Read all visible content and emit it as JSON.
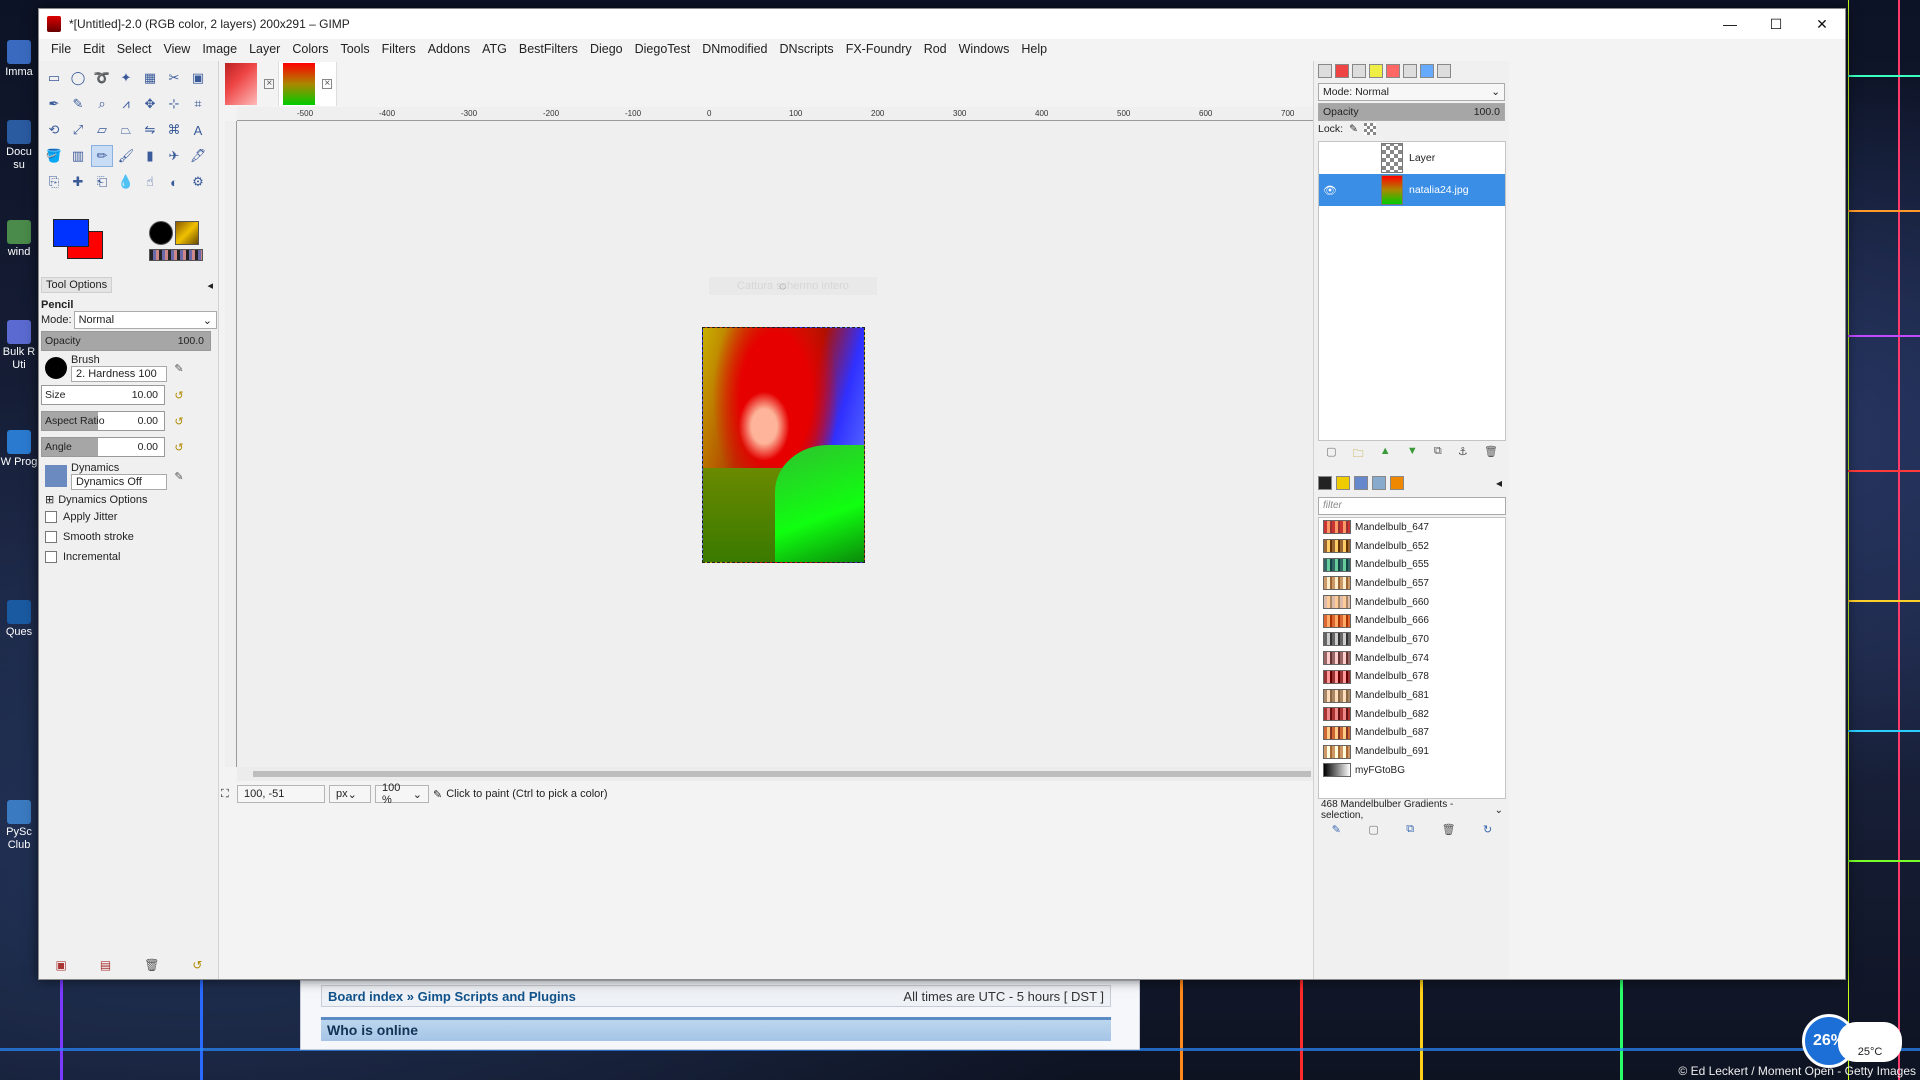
{
  "window": {
    "title": "*[Untitled]-2.0 (RGB color, 2 layers) 200x291 – GIMP",
    "controls": {
      "minimize": "—",
      "maximize": "☐",
      "close": "✕"
    }
  },
  "menu": [
    "File",
    "Edit",
    "Select",
    "View",
    "Image",
    "Layer",
    "Colors",
    "Tools",
    "Filters",
    "Addons",
    "ATG",
    "BestFilters",
    "Diego",
    "DiegoTest",
    "DNmodified",
    "DNscripts",
    "FX-Foundry",
    "Rod",
    "Windows",
    "Help"
  ],
  "desktop_icons": [
    "Imma",
    "Docu su",
    "wind",
    "Bulk R Uti",
    "W Prog",
    "Ques",
    "PySc Club"
  ],
  "tool_options": {
    "tab": "Tool Options",
    "tool_name": "Pencil",
    "mode_label": "Mode:",
    "mode_value": "Normal",
    "opacity_label": "Opacity",
    "opacity_value": "100.0",
    "brush_label": "Brush",
    "brush_value": "2. Hardness 100",
    "size_label": "Size",
    "size_value": "10.00",
    "aspect_label": "Aspect Ratio",
    "aspect_value": "0.00",
    "angle_label": "Angle",
    "angle_value": "0.00",
    "dynamics_label": "Dynamics",
    "dynamics_value": "Dynamics Off",
    "dynamics_options": "Dynamics Options",
    "apply_jitter": "Apply Jitter",
    "smooth_stroke": "Smooth stroke",
    "incremental": "Incremental"
  },
  "colors": {
    "foreground": "#0033ff",
    "background": "#ff0000"
  },
  "ruler_labels": [
    "-500",
    "-400",
    "-300",
    "-200",
    "-100",
    "0",
    "100",
    "200",
    "300",
    "400",
    "500",
    "600",
    "700"
  ],
  "canvas": {
    "ghost_text": "Cattura schermo intero"
  },
  "statusbar": {
    "coords": "100, -51",
    "unit": "px",
    "zoom": "100 %",
    "message": "Click to paint (Ctrl to pick a color)"
  },
  "layers": {
    "mode_label": "Mode: Normal",
    "opacity_label": "Opacity",
    "opacity_value": "100.0",
    "lock_label": "Lock:",
    "items": [
      {
        "name": "Layer",
        "visible": false,
        "selected": false
      },
      {
        "name": "natalia24.jpg",
        "visible": true,
        "selected": true
      }
    ]
  },
  "gradients": {
    "filter_placeholder": "filter",
    "items": [
      "Mandelbulb_647",
      "Mandelbulb_652",
      "Mandelbulb_655",
      "Mandelbulb_657",
      "Mandelbulb_660",
      "Mandelbulb_666",
      "Mandelbulb_670",
      "Mandelbulb_674",
      "Mandelbulb_678",
      "Mandelbulb_681",
      "Mandelbulb_682",
      "Mandelbulb_687",
      "Mandelbulb_691",
      "myFGtoBG"
    ],
    "footer": "468 Mandelbulber  Gradients - selection,"
  },
  "forum": {
    "board_index": "Board index",
    "separator": "»",
    "section": "Gimp Scripts and Plugins",
    "timezone": "All times are UTC - 5 hours [ DST ]",
    "who_online": "Who is online"
  },
  "tray": {
    "cpu": "26%",
    "temperature": "25°C"
  },
  "credit": "© Ed Leckert / Moment Open - Getty Images"
}
